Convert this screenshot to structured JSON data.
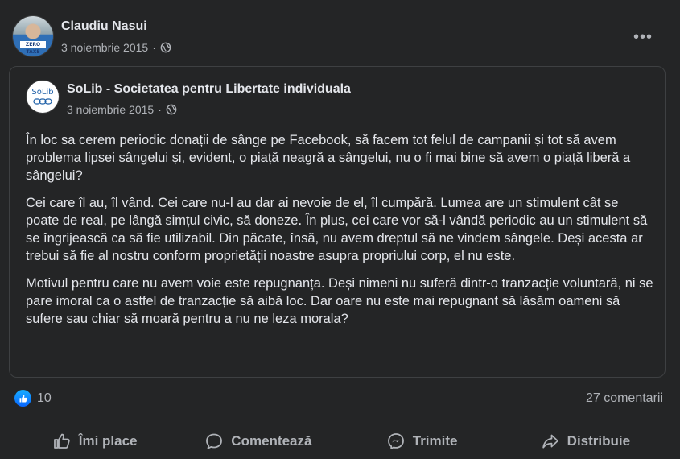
{
  "author": {
    "name": "Claudiu Nasui",
    "date": "3 noiembrie 2015",
    "separator": "·",
    "avatar_badge_text": "ZERO TAXE"
  },
  "menu": {
    "more_glyph": "•••"
  },
  "shared_post": {
    "page_name": "SoLib - Societatea pentru Libertate individuala",
    "page_logo_text": "SoLib",
    "date": "3 noiembrie 2015",
    "separator": "·",
    "paragraphs": [
      "În loc sa cerem periodic donații de sânge  pe Facebook, să facem tot felul de campanii și tot să avem problema lipsei sângelui și, evident, o piață neagră a sângelui, nu o fi mai bine să avem o piață liberă a sângelui?",
      "Cei care îl au, îl vând. Cei care nu-l au dar ai nevoie de el, îl cumpără. Lumea are un stimulent cât se poate de real, pe lângă simțul civic, să doneze. În plus, cei care vor să-l vândă periodic au un stimulent să se îngrijească ca să fie utilizabil. Din păcate, însă, nu avem dreptul să ne vindem sângele. Deși acesta ar trebui să fie al nostru conform proprietății noastre asupra propriului corp, el nu este.",
      "Motivul pentru care nu avem voie este repugnanța. Deși nimeni nu suferă dintr-o tranzacție voluntară, ni se pare imoral ca o astfel de tranzacție să aibă loc. Dar oare nu este mai repugnant să lăsăm oameni să sufere sau chiar să moară pentru a nu ne leza morala?"
    ]
  },
  "stats": {
    "reactions": "10",
    "comments": "27 comentarii"
  },
  "actions": {
    "like": "Îmi place",
    "comment": "Comentează",
    "send": "Trimite",
    "share": "Distribuie"
  },
  "icons": {
    "privacy": "globe-icon",
    "like": "thumbs-up-icon",
    "comment": "speech-bubble-icon",
    "send": "messenger-icon",
    "share": "share-arrow-icon"
  },
  "colors": {
    "background": "#242526",
    "text_primary": "#e4e6eb",
    "text_secondary": "#b0b3b8",
    "like_blue": "#0866ff",
    "border": "#3e4042"
  }
}
